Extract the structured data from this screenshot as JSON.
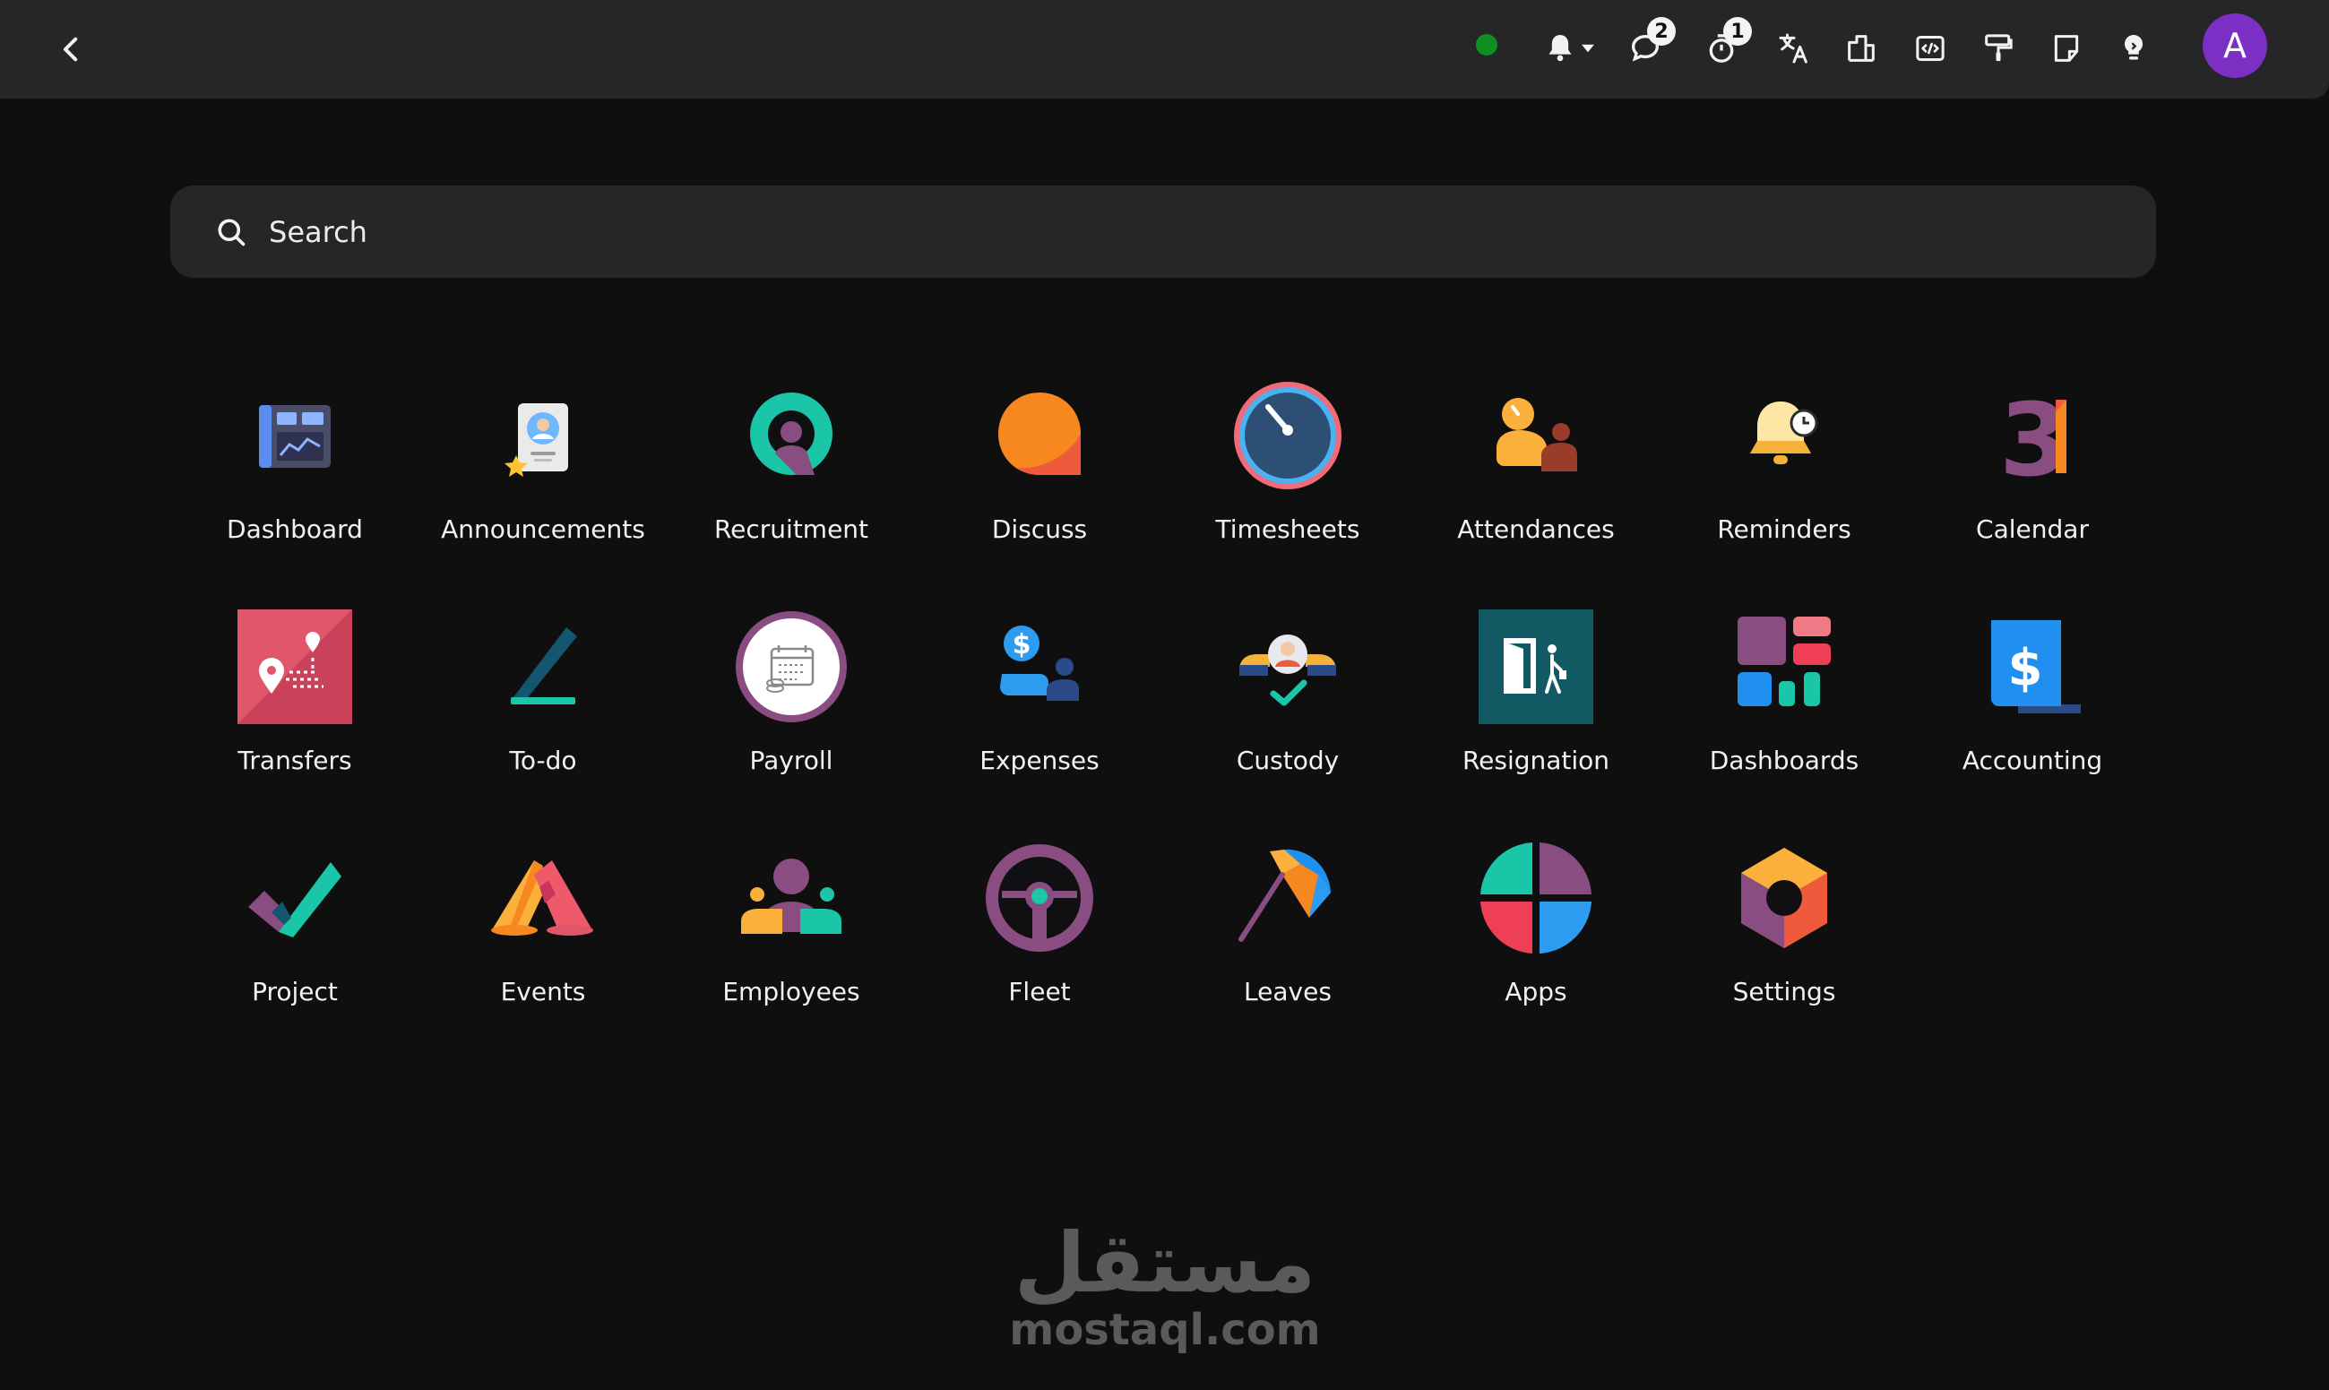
{
  "header": {
    "back_label": "Back"
  },
  "systray": {
    "status_color": "#0e8f1e",
    "messages_count": "2",
    "activities_count": "1",
    "avatar_letter": "A",
    "avatar_color": "#7b2fc4"
  },
  "search": {
    "placeholder": "Search"
  },
  "apps": [
    {
      "label": "Dashboard",
      "icon": "dashboard-icon"
    },
    {
      "label": "Announcements",
      "icon": "announcements-icon"
    },
    {
      "label": "Recruitment",
      "icon": "recruitment-icon"
    },
    {
      "label": "Discuss",
      "icon": "discuss-icon"
    },
    {
      "label": "Timesheets",
      "icon": "timesheets-icon"
    },
    {
      "label": "Attendances",
      "icon": "attendances-icon"
    },
    {
      "label": "Reminders",
      "icon": "reminders-icon"
    },
    {
      "label": "Calendar",
      "icon": "calendar-icon",
      "glyph": "31"
    },
    {
      "label": "Transfers",
      "icon": "transfers-icon"
    },
    {
      "label": "To-do",
      "icon": "todo-icon"
    },
    {
      "label": "Payroll",
      "icon": "payroll-icon"
    },
    {
      "label": "Expenses",
      "icon": "expenses-icon",
      "glyph": "$"
    },
    {
      "label": "Custody",
      "icon": "custody-icon"
    },
    {
      "label": "Resignation",
      "icon": "resignation-icon"
    },
    {
      "label": "Dashboards",
      "icon": "dashboards-icon"
    },
    {
      "label": "Accounting",
      "icon": "accounting-icon",
      "glyph": "$"
    },
    {
      "label": "Project",
      "icon": "project-icon"
    },
    {
      "label": "Events",
      "icon": "events-icon"
    },
    {
      "label": "Employees",
      "icon": "employees-icon"
    },
    {
      "label": "Fleet",
      "icon": "fleet-icon"
    },
    {
      "label": "Leaves",
      "icon": "leaves-icon"
    },
    {
      "label": "Apps",
      "icon": "apps-icon"
    },
    {
      "label": "Settings",
      "icon": "settings-icon"
    }
  ],
  "watermark": {
    "arabic": "مستقل",
    "latin": "mostaql.com"
  }
}
